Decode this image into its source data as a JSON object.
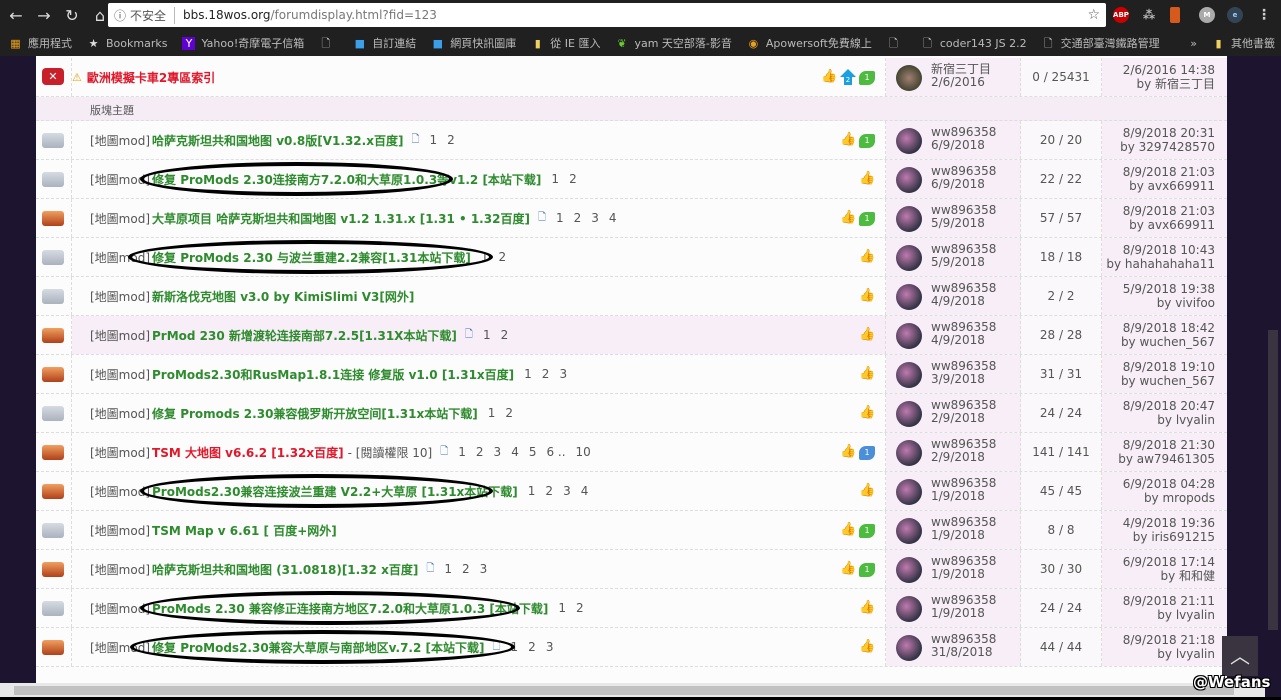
{
  "browser": {
    "security_label": "不安全",
    "url_host": "bbs.18wos.org",
    "url_path": "/forumdisplay.html?fid=123",
    "extensions": [
      "ABP",
      "dropbox",
      "office",
      "M",
      "e"
    ],
    "bookmarks": [
      {
        "icon": "apps-icon",
        "label": "應用程式"
      },
      {
        "icon": "star-icon",
        "label": "Bookmarks"
      },
      {
        "icon": "yahoo-icon",
        "label": "Yahoo!奇摩電子信箱"
      },
      {
        "icon": "page-icon",
        "label": ""
      },
      {
        "icon": "windows-icon",
        "label": "自訂連結"
      },
      {
        "icon": "windows-icon",
        "label": "網頁快訊圖庫"
      },
      {
        "icon": "folder-icon",
        "label": "從 IE 匯入"
      },
      {
        "icon": "yam-icon",
        "label": "yam 天空部落-影音"
      },
      {
        "icon": "apowersoft-icon",
        "label": "Apowersoft免費線上"
      },
      {
        "icon": "page-icon",
        "label": ""
      },
      {
        "icon": "page-icon",
        "label": "coder143 JS 2.2"
      },
      {
        "icon": "page-icon",
        "label": "交通部臺灣鐵路管理"
      }
    ],
    "more_label": "»",
    "other_bookmarks": "其他書籤"
  },
  "pinned": {
    "title": "歐洲模擬卡車2專區索引",
    "author": "新宿三丁目",
    "date": "2/6/2016",
    "replies": "0 / 25431",
    "last_time": "2/6/2016 14:38",
    "last_by": "by 新宿三丁目"
  },
  "section_label": "版塊主題",
  "colors": {
    "green": "#2e8b2e",
    "red": "#e0182a"
  },
  "threads": [
    {
      "folder": "gray",
      "prefix": "[地圖mod]",
      "title": "哈萨克斯坦共和国地图 v0.8版[V1.32.x百度]",
      "color": "green",
      "file": true,
      "extra": "",
      "pages": [
        "1",
        "2"
      ],
      "rec": "green",
      "author": "ww896358",
      "date": "6/9/2018",
      "replies": "20 / 20",
      "last_time": "8/9/2018 20:31",
      "last_by": "by 3297428570",
      "circled": false
    },
    {
      "folder": "gray",
      "prefix": "[地圖mod]",
      "title": "修复 ProMods 2.30连接南方7.2.0和大草原1.0.3等v1.2 [本站下载]",
      "color": "green",
      "file": false,
      "extra": "",
      "pages": [
        "1",
        "2"
      ],
      "rec": "",
      "author": "ww896358",
      "date": "6/9/2018",
      "replies": "22 / 22",
      "last_time": "8/9/2018 21:03",
      "last_by": "by avx669911",
      "circled": true
    },
    {
      "folder": "hot",
      "prefix": "[地圖mod]",
      "title": "大草原项目 哈萨克斯坦共和国地图 v1.2 1.31.x [1.31 • 1.32百度]",
      "color": "green",
      "file": true,
      "extra": "",
      "pages": [
        "1",
        "2",
        "3",
        "4"
      ],
      "rec": "green",
      "author": "ww896358",
      "date": "5/9/2018",
      "replies": "57 / 57",
      "last_time": "8/9/2018 21:03",
      "last_by": "by avx669911",
      "circled": false
    },
    {
      "folder": "gray",
      "prefix": "[地圖mod]",
      "title": "修复 ProMods 2.30 与波兰重建2.2兼容[1.31本站下载]",
      "color": "green",
      "file": false,
      "extra": "",
      "pages": [
        "1",
        "2"
      ],
      "rec": "",
      "author": "ww896358",
      "date": "5/9/2018",
      "replies": "18 / 18",
      "last_time": "8/9/2018 10:43",
      "last_by": "by hahahahaha11",
      "circled": true
    },
    {
      "folder": "gray",
      "prefix": "[地圖mod]",
      "title": "新斯洛伐克地图 v3.0 by KimiSlimi V3[网外]",
      "color": "green",
      "file": false,
      "extra": "",
      "pages": [],
      "rec": "",
      "author": "ww896358",
      "date": "4/9/2018",
      "replies": "2 / 2",
      "last_time": "5/9/2018 19:38",
      "last_by": "by vivifoo",
      "circled": false
    },
    {
      "folder": "hot",
      "prefix": "[地圖mod]",
      "title": "PrMod 230 新增渡轮连接南部7.2.5[1.31X本站下载]",
      "color": "green",
      "file": true,
      "extra": "",
      "pages": [
        "1",
        "2"
      ],
      "rec": "",
      "author": "ww896358",
      "date": "4/9/2018",
      "replies": "28 / 28",
      "last_time": "8/9/2018 18:42",
      "last_by": "by wuchen_567",
      "circled": true
    },
    {
      "folder": "hot",
      "prefix": "[地圖mod]",
      "title": "ProMods2.30和RusMap1.8.1连接 修复版 v1.0 [1.31x百度]",
      "color": "green",
      "file": false,
      "extra": "",
      "pages": [
        "1",
        "2",
        "3"
      ],
      "rec": "",
      "author": "ww896358",
      "date": "3/9/2018",
      "replies": "31 / 31",
      "last_time": "8/9/2018 19:10",
      "last_by": "by wuchen_567",
      "circled": true
    },
    {
      "folder": "gray",
      "prefix": "[地圖mod]",
      "title": "修复 Promods 2.30兼容俄罗斯开放空间[1.31x本站下载]",
      "color": "green",
      "file": false,
      "extra": "",
      "pages": [
        "1",
        "2"
      ],
      "rec": "",
      "author": "ww896358",
      "date": "2/9/2018",
      "replies": "24 / 24",
      "last_time": "8/9/2018 20:47",
      "last_by": "by lvyalin",
      "circled": true
    },
    {
      "folder": "hot",
      "prefix": "[地圖mod]",
      "title": "TSM 大地图 v6.6.2 [1.32x百度]",
      "color": "red",
      "file": true,
      "extra": "- [閱讀權限 10]",
      "pages": [
        "1",
        "2",
        "3",
        "4",
        "5",
        "6 ..",
        "10"
      ],
      "rec": "blue",
      "author": "ww896358",
      "date": "2/9/2018",
      "replies": "141 / 141",
      "last_time": "8/9/2018 21:30",
      "last_by": "by aw79461305",
      "circled": false
    },
    {
      "folder": "hot",
      "prefix": "[地圖mod]",
      "title": "ProMods2.30兼容连接波兰重建 V2.2+大草原 [1.31x本站下载]",
      "color": "green",
      "file": false,
      "extra": "",
      "pages": [
        "1",
        "2",
        "3",
        "4"
      ],
      "rec": "",
      "author": "ww896358",
      "date": "1/9/2018",
      "replies": "45 / 45",
      "last_time": "6/9/2018 04:28",
      "last_by": "by mropods",
      "circled": true
    },
    {
      "folder": "gray",
      "prefix": "[地圖mod]",
      "title": "TSM Map v 6.61 [ 百度+网外]",
      "color": "green",
      "file": false,
      "extra": "",
      "pages": [],
      "rec": "green",
      "author": "ww896358",
      "date": "1/9/2018",
      "replies": "8 / 8",
      "last_time": "4/9/2018 19:36",
      "last_by": "by iris691215",
      "circled": false
    },
    {
      "folder": "hot",
      "prefix": "[地圖mod]",
      "title": "哈萨克斯坦共和国地图 (31.0818)[1.32 x百度]",
      "color": "green",
      "file": true,
      "extra": "",
      "pages": [
        "1",
        "2",
        "3"
      ],
      "rec": "green",
      "author": "ww896358",
      "date": "1/9/2018",
      "replies": "30 / 30",
      "last_time": "6/9/2018 17:14",
      "last_by": "by 和和健",
      "circled": false
    },
    {
      "folder": "gray",
      "prefix": "[地圖mod]",
      "title": "ProMods 2.30 兼容修正连接南方地区7.2.0和大草原1.0.3 [本站下载]",
      "color": "green",
      "file": false,
      "extra": "",
      "pages": [
        "1",
        "2"
      ],
      "rec": "",
      "author": "ww896358",
      "date": "1/9/2018",
      "replies": "24 / 24",
      "last_time": "8/9/2018 21:11",
      "last_by": "by lvyalin",
      "circled": true
    },
    {
      "folder": "hot",
      "prefix": "[地圖mod]",
      "title": "修复 ProMods2.30兼容大草原与南部地区v.7.2 [本站下载]",
      "color": "green",
      "file": true,
      "extra": "",
      "pages": [
        "1",
        "2",
        "3"
      ],
      "rec": "",
      "author": "ww896358",
      "date": "31/8/2018",
      "replies": "44 / 44",
      "last_time": "8/9/2018 21:18",
      "last_by": "by lvyalin",
      "circled": true
    }
  ],
  "watermark": "@Wefans"
}
